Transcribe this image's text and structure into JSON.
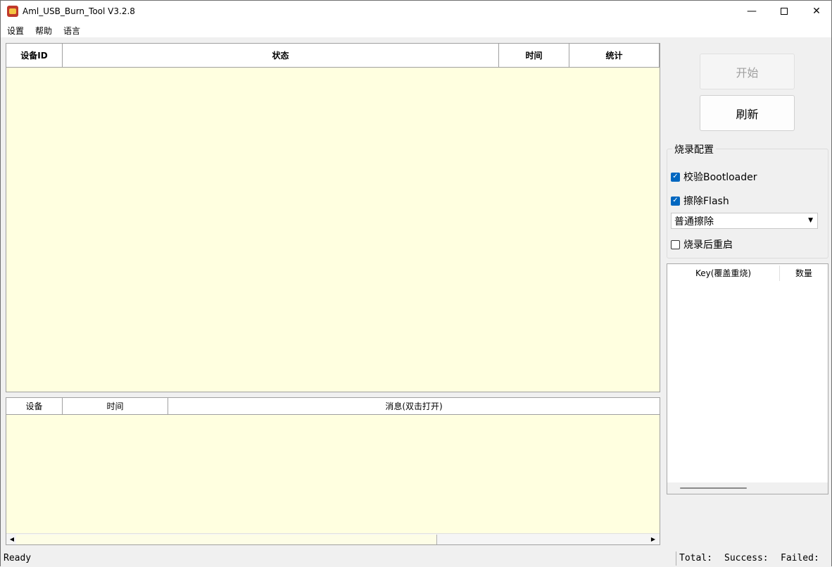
{
  "window": {
    "title": "Aml_USB_Burn_Tool V3.2.8",
    "minimize_icon": "minimize-icon",
    "maximize_icon": "maximize-icon",
    "close_icon": "close-icon"
  },
  "menu": {
    "settings": "设置",
    "help": "帮助",
    "language": "语言"
  },
  "device_table": {
    "columns": [
      "设备ID",
      "状态",
      "时间",
      "统计"
    ]
  },
  "log_table": {
    "columns": [
      "设备",
      "时间",
      "消息(双击打开)"
    ]
  },
  "buttons": {
    "start": "开始",
    "refresh": "刷新"
  },
  "burn_config": {
    "title": "烧录配置",
    "verify_bootloader": {
      "label": "校验Bootloader",
      "checked": true
    },
    "erase_flash": {
      "label": "擦除Flash",
      "checked": true
    },
    "erase_mode": "普通擦除",
    "reboot_after": {
      "label": "烧录后重启",
      "checked": false
    }
  },
  "key_table": {
    "columns": [
      "Key(覆盖重烧)",
      "数量"
    ]
  },
  "status_bar": {
    "ready": "Ready",
    "total": "Total:",
    "success": "Success:",
    "failed": "Failed:"
  },
  "colors": {
    "grid_background": "#ffffe0",
    "checkbox_accent": "#0067c0"
  }
}
